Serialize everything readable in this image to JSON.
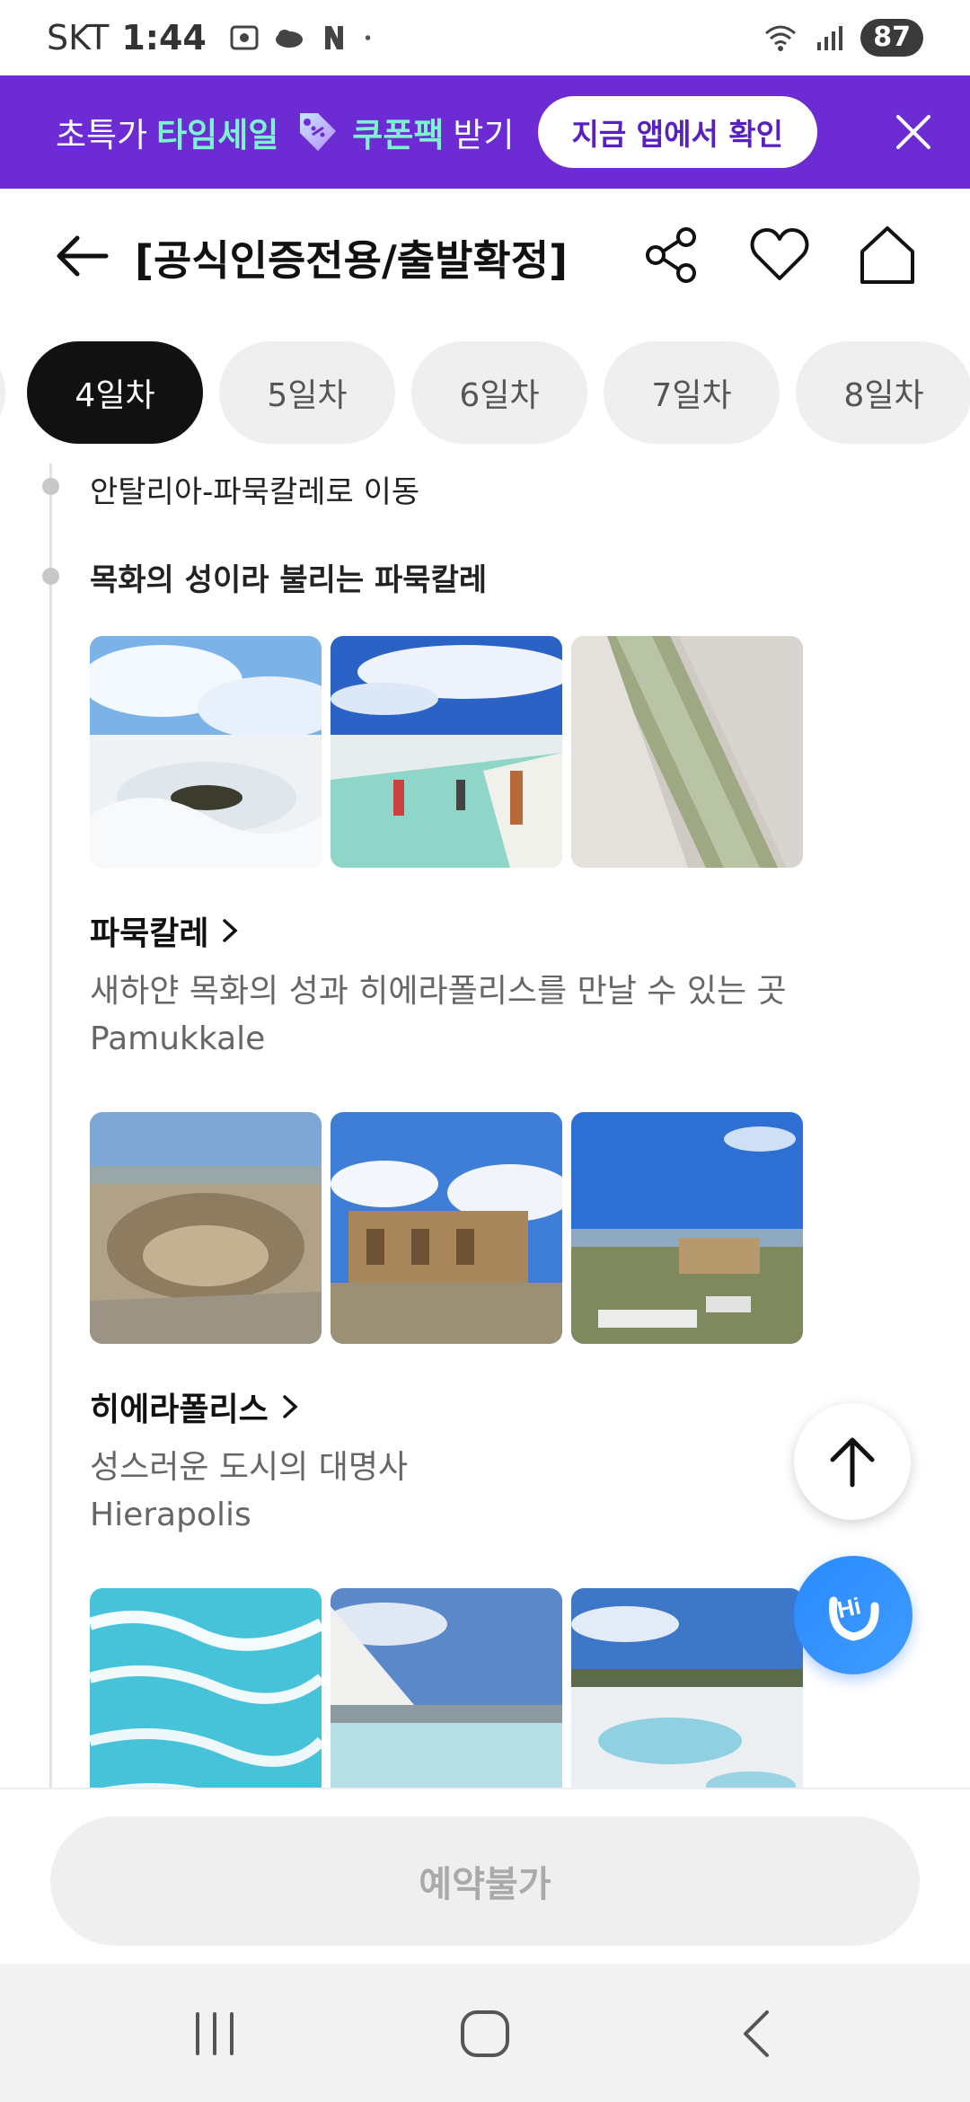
{
  "status_bar": {
    "carrier": "SKT",
    "time": "1:44",
    "battery": "87",
    "icons": [
      "screenshot-icon",
      "cloud-icon",
      "naver-n-icon",
      "notification-dot-icon",
      "wifi-icon",
      "signal-icon",
      "battery-icon"
    ]
  },
  "promo": {
    "text_1": "초특가",
    "accent_1": "타임세일",
    "accent_2": "쿠폰팩",
    "text_2": "받기",
    "button_label": "지금 앱에서 확인",
    "background_color": "#6c2bd3",
    "accent_color": "#7ef3d1"
  },
  "header": {
    "title": "[공식인증전용/출발확정]"
  },
  "day_tabs": [
    {
      "label": "4일차",
      "active": true
    },
    {
      "label": "5일차",
      "active": false
    },
    {
      "label": "6일차",
      "active": false
    },
    {
      "label": "7일차",
      "active": false
    },
    {
      "label": "8일차",
      "active": false
    }
  ],
  "timeline": {
    "step_1": "안탈리아-파묵칼레로 이동",
    "step_2": "목화의 성이라 불리는 파묵칼레"
  },
  "places": [
    {
      "name": "파묵칼레",
      "description": "새하얀 목화의 성과 히에라폴리스를 만날 수 있는 곳",
      "name_en": "Pamukkale"
    },
    {
      "name": "히에라폴리스",
      "description": "성스러운 도시의 대명사",
      "name_en": "Hierapolis"
    }
  ],
  "bottom": {
    "reserve_label": "예약불가"
  },
  "floating": {
    "hi_label": "Hi"
  }
}
